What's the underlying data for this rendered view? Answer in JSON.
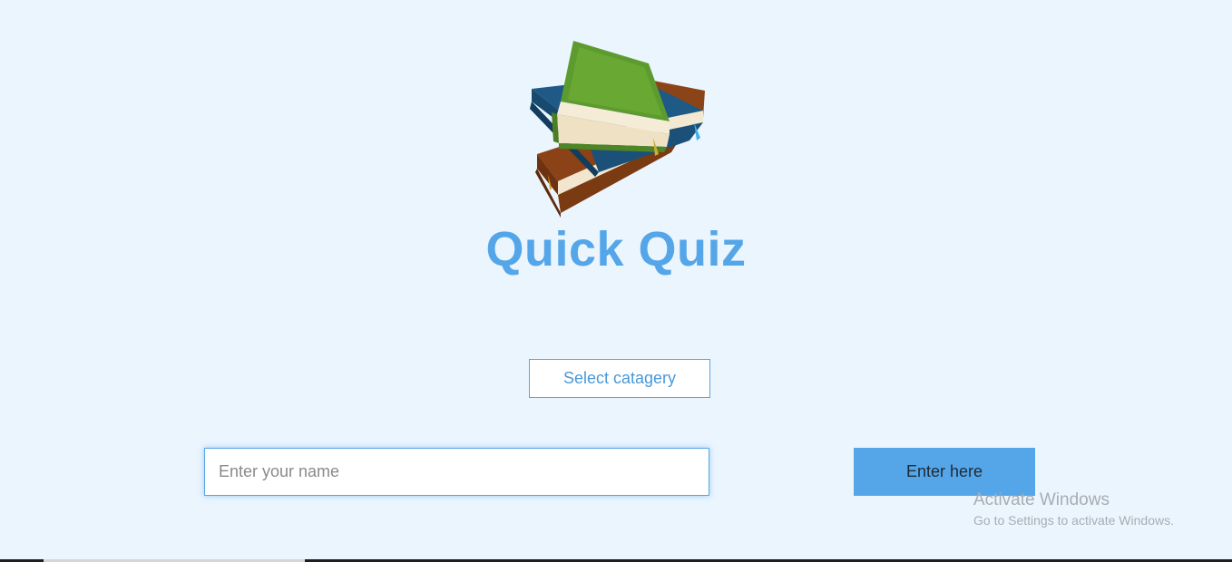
{
  "app": {
    "title": "Quick Quiz",
    "logo_icon": "stacked-books-icon"
  },
  "category": {
    "label": "Select catagery"
  },
  "name_input": {
    "value": "",
    "placeholder": "Enter your name"
  },
  "enter_button": {
    "label": "Enter here"
  },
  "watermark": {
    "title": "Activate Windows",
    "subtitle": "Go to Settings to activate Windows."
  },
  "colors": {
    "background": "#ebf5fe",
    "accent": "#55a6e8",
    "button_text": "#1f2a36"
  }
}
